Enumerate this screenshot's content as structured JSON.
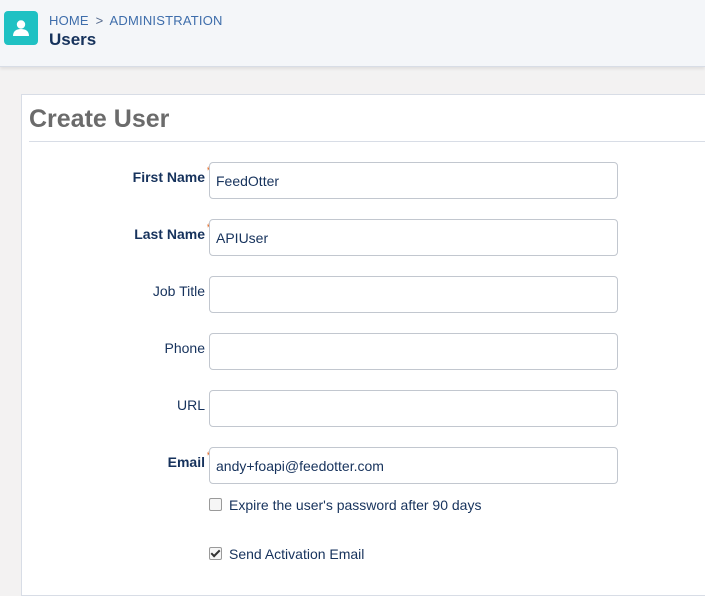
{
  "header": {
    "breadcrumb": {
      "home": "HOME",
      "separator": ">",
      "section": "ADMINISTRATION"
    },
    "title": "Users",
    "icon": "user-icon",
    "icon_color": "#1fc1c3"
  },
  "form": {
    "title": "Create User",
    "required_marker": "*",
    "fields": [
      {
        "label": "First Name",
        "value": "FeedOtter",
        "placeholder": "",
        "required": true
      },
      {
        "label": "Last Name",
        "value": "APIUser",
        "placeholder": "",
        "required": true
      },
      {
        "label": "Job Title",
        "value": "",
        "placeholder": "",
        "required": false
      },
      {
        "label": "Phone",
        "value": "",
        "placeholder": "",
        "required": false
      },
      {
        "label": "URL",
        "value": "",
        "placeholder": "",
        "required": false
      },
      {
        "label": "Email",
        "value": "andy+foapi@feedotter.com",
        "placeholder": "",
        "required": true
      }
    ],
    "checkboxes": [
      {
        "label": "Expire the user's password after 90 days",
        "checked": false
      },
      {
        "label": "Send Activation Email",
        "checked": true
      }
    ]
  }
}
